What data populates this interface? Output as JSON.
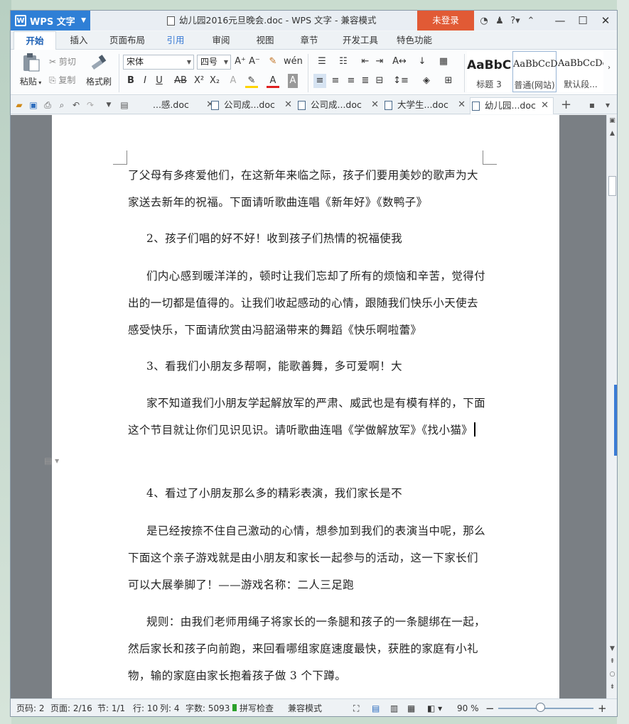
{
  "window": {
    "app_button": "WPS 文字",
    "title": "幼儿园2016元旦晚会.doc - WPS 文字 - 兼容模式",
    "login_button": "未登录"
  },
  "menu": {
    "tabs": [
      "开始",
      "插入",
      "页面布局",
      "引用",
      "审阅",
      "视图",
      "章节",
      "开发工具",
      "特色功能"
    ],
    "active": "开始"
  },
  "ribbon": {
    "paste": "粘贴",
    "cut": "剪切",
    "copy": "复制",
    "format_painter": "格式刷",
    "font_name": "宋体",
    "font_size": "四号",
    "styles": [
      {
        "sample": "AaBbC",
        "name": "标题 3"
      },
      {
        "sample": "AaBbCcD",
        "name": "普通(网站)"
      },
      {
        "sample": "AaBbCcDc",
        "name": "默认段..."
      }
    ]
  },
  "doc_tabs": [
    {
      "label": "...感.doc",
      "active": false
    },
    {
      "label": "公司成...doc",
      "active": false
    },
    {
      "label": "公司成...doc",
      "active": false
    },
    {
      "label": "大学生...doc",
      "active": false
    },
    {
      "label": "幼儿园...doc",
      "active": true
    }
  ],
  "document": {
    "paragraphs": [
      "了父母有多疼爱他们，在这新年来临之际，孩子们要用美妙的歌声为大家送去新年的祝福。下面请听歌曲连唱《新年好》《数鸭子》",
      "2、孩子们唱的好不好！收到孩子们热情的祝福使我",
      "们内心感到暖洋洋的，顿时让我们忘却了所有的烦恼和辛苦，觉得付出的一切都是值得的。让我们收起感动的心情，跟随我们快乐小天使去感受快乐，下面请欣赏由冯韶涵带来的舞蹈《快乐啊啦蕾》",
      "3、看我们小朋友多帮啊，能歌善舞，多可爱啊！大",
      "家不知道我们小朋友学起解放军的严肃、威武也是有模有样的，下面这个节目就让你们见识见识。请听歌曲连唱《学做解放军》《找小猫》",
      "4、看过了小朋友那么多的精彩表演，我们家长是不",
      "是已经按捺不住自己激动的心情，想参加到我们的表演当中呢，那么下面这个亲子游戏就是由小朋友和家长一起参与的活动，这一下家长们可以大展拳脚了！——游戏名称：二人三足跑",
      "规则：由我们老师用绳子将家长的一条腿和孩子的一条腿绑在一起，然后家长和孩子向前跑，来回看哪组家庭速度最快，获胜的家庭有小礼物，输的家庭由家长抱着孩子做 3 个下蹲。"
    ]
  },
  "status": {
    "page_code": "页码: 2",
    "page": "页面: 2/16",
    "section": "节: 1/1",
    "row": "行: 10",
    "col": "列: 4",
    "words": "字数: 5093",
    "spell": "拼写检查",
    "compat": "兼容模式",
    "zoom": "90 %"
  },
  "colors": {
    "accent": "#2f7fd6",
    "login": "#e15a35"
  }
}
